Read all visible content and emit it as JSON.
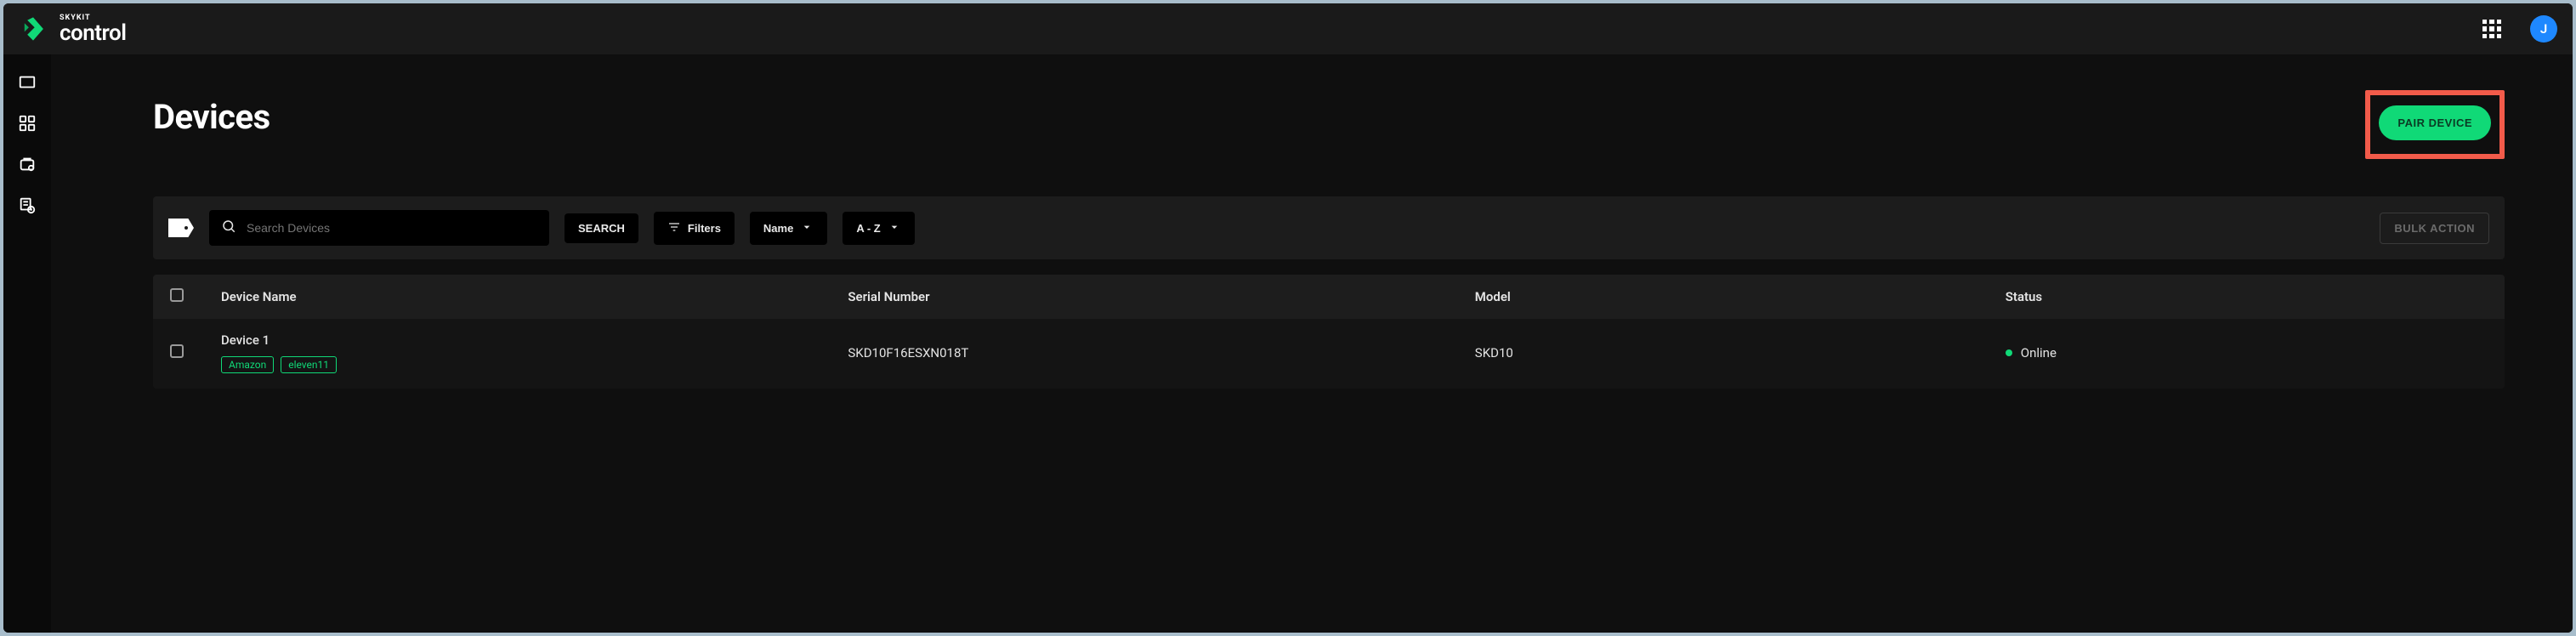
{
  "brand": {
    "sub": "SKYKIT",
    "main": "control"
  },
  "userInitial": "J",
  "page": {
    "title": "Devices",
    "pairButton": "PAIR DEVICE"
  },
  "toolbar": {
    "searchPlaceholder": "Search Devices",
    "searchBtn": "SEARCH",
    "filtersBtn": "Filters",
    "sortField": "Name",
    "sortDir": "A - Z",
    "bulk": "BULK ACTION"
  },
  "table": {
    "headers": {
      "name": "Device Name",
      "serial": "Serial Number",
      "model": "Model",
      "status": "Status"
    },
    "rows": [
      {
        "name": "Device 1",
        "serial": "SKD10F16ESXN018T",
        "model": "SKD10",
        "status": "Online",
        "tags": [
          "Amazon",
          "eleven11"
        ]
      }
    ]
  }
}
